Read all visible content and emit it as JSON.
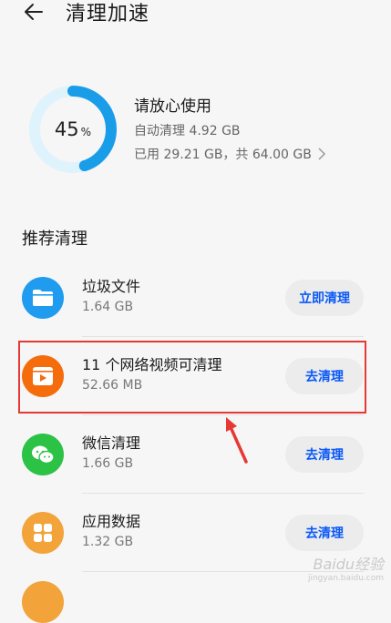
{
  "header": {
    "title": "清理加速",
    "back_icon": "arrow-left-icon"
  },
  "storage": {
    "percent": 45,
    "percent_value": "45",
    "percent_unit": "%",
    "title": "请放心使用",
    "auto_clean": "自动清理 4.92 GB",
    "used": "已用 29.21 GB，共 64.00 GB",
    "ring_color": "#1a9de8",
    "ring_track_color": "#dff3fc"
  },
  "section": {
    "title": "推荐清理"
  },
  "items": [
    {
      "title": "垃圾文件",
      "size": "1.64 GB",
      "action": "立即清理",
      "icon": "folder-icon",
      "color": "#1f9cf0"
    },
    {
      "title": "11 个网络视频可清理",
      "size": "52.66 MB",
      "action": "去清理",
      "icon": "video-icon",
      "color": "#f56c0c"
    },
    {
      "title": "微信清理",
      "size": "1.66 GB",
      "action": "去清理",
      "icon": "wechat-icon",
      "color": "#2bc246"
    },
    {
      "title": "应用数据",
      "size": "1.32 GB",
      "action": "去清理",
      "icon": "apps-icon",
      "color": "#f2a33a"
    }
  ],
  "watermark": {
    "line1": "Baidu经验",
    "line2": "jingyan.baidu.com"
  },
  "annotation_color": "#e53935"
}
